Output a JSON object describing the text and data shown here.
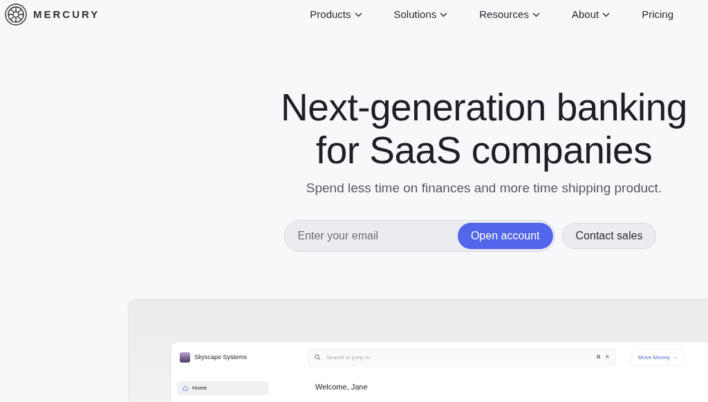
{
  "header": {
    "brand": "MERCURY",
    "nav": [
      {
        "label": "Products",
        "has_menu": true
      },
      {
        "label": "Solutions",
        "has_menu": true
      },
      {
        "label": "Resources",
        "has_menu": true
      },
      {
        "label": "About",
        "has_menu": true
      },
      {
        "label": "Pricing",
        "has_menu": false
      }
    ]
  },
  "hero": {
    "title_lines": [
      "Next-generation banking",
      "for SaaS companies"
    ],
    "subtitle": "Spend less time on finances and more time shipping product.",
    "email": {
      "placeholder": "Enter your email"
    },
    "primary_button": "Open account",
    "secondary_button": "Contact sales"
  },
  "app_preview": {
    "company": "Skyscape Systems",
    "search": {
      "placeholder": "Search or jump to"
    },
    "shortcut_keys": [
      "⌘",
      "K"
    ],
    "move_money": "Move Money",
    "sidebar": [
      {
        "label": "Home",
        "selected": true
      }
    ],
    "greeting": "Welcome, Jane"
  }
}
